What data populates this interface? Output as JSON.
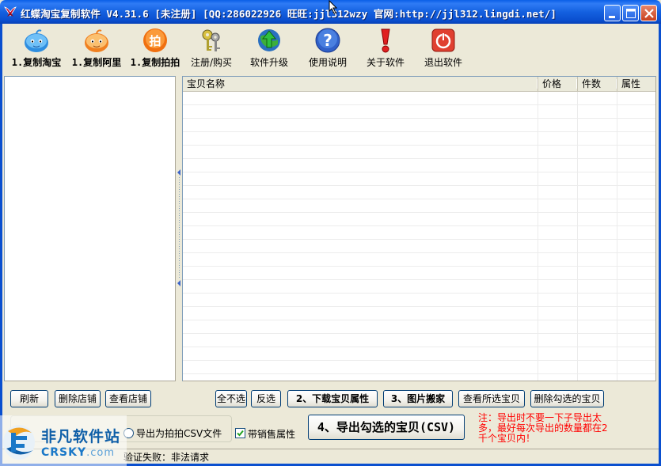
{
  "window": {
    "title": "红蝶淘宝复制软件 V4.31.6 [未注册] [QQ:286022926 旺旺:jjl312wzy 官网:http://jjl312.lingdi.net/]"
  },
  "toolbar": {
    "items": [
      {
        "label": "1.复制淘宝",
        "icon": "taobao-icon"
      },
      {
        "label": "1.复制阿里",
        "icon": "alibaba-icon"
      },
      {
        "label": "1.复制拍拍",
        "icon": "paipai-icon"
      },
      {
        "label": "注册/购买",
        "icon": "keys-icon"
      },
      {
        "label": "软件升级",
        "icon": "upgrade-icon"
      },
      {
        "label": "使用说明",
        "icon": "help-icon"
      },
      {
        "label": "关于软件",
        "icon": "exclamation-icon"
      },
      {
        "label": "退出软件",
        "icon": "power-icon"
      }
    ]
  },
  "grid": {
    "columns": [
      "宝贝名称",
      "价格",
      "件数",
      "属性"
    ],
    "rows": []
  },
  "buttons": {
    "refresh": "刷新",
    "delete_shop": "删除店铺",
    "view_shop": "查看店铺",
    "select_none": "全不选",
    "invert": "反选",
    "download_attrs": "2、下载宝贝属性",
    "move_images": "3、图片搬家",
    "view_selected": "查看所选宝贝",
    "delete_checked": "删除勾选的宝贝",
    "export_csv": "4、导出勾选的宝贝(CSV)"
  },
  "options": {
    "export_paipai_label": "导出为拍拍CSV文件",
    "export_paipai_checked": false,
    "with_sales_attr_label": "带销售属性",
    "with_sales_attr_checked": true
  },
  "note": "注：导出时不要一下子导出太多，最好每次导出的数量都在2千个宝贝内！",
  "status": {
    "text": "验证失败：非法请求"
  },
  "watermark": {
    "cn": "非凡软件站",
    "en": "CRSKY",
    "en_suffix": ".com"
  },
  "colors": {
    "titlebar": "#0a5fe8",
    "note_red": "#ff0000",
    "window_bg": "#ece9d8"
  }
}
